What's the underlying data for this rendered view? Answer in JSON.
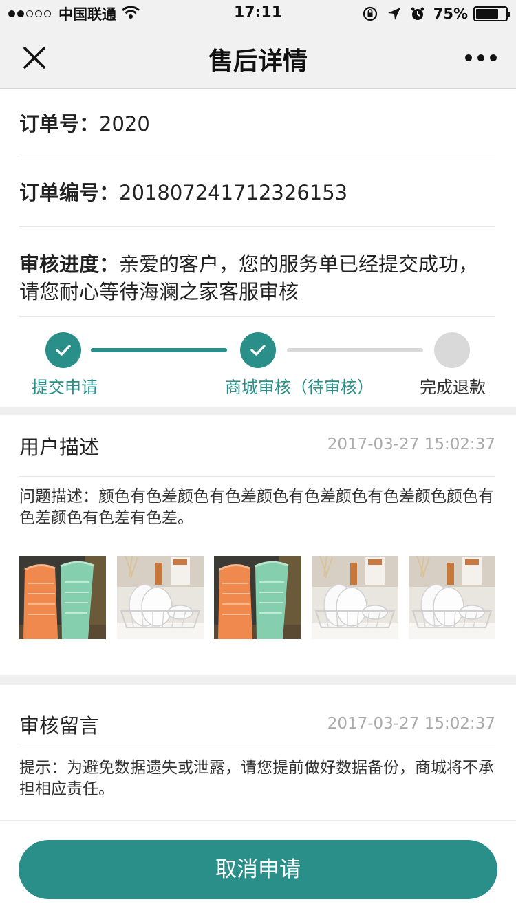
{
  "status_bar": {
    "carrier": "中国联通",
    "time": "17:11",
    "battery_percent": "75%",
    "battery_level": 0.75,
    "signal_bars_filled": 2,
    "signal_bars_total": 5,
    "icons": [
      "wifi-icon",
      "orientation-lock-icon",
      "location-arrow-icon",
      "alarm-icon",
      "battery-icon"
    ]
  },
  "nav": {
    "title": "售后详情",
    "close_icon": "close-icon",
    "more_icon": "more-dots-icon"
  },
  "order": {
    "order_label": "订单号：",
    "order_value": "2020",
    "number_label": "订单编号：",
    "number_value": "20180724171232615​3",
    "progress_label": "审核进度：",
    "progress_text": "亲爱的客户，您的服务单已经提交成功，请您耐心等待海澜之家客服审核"
  },
  "steps": [
    {
      "label": "提交申请",
      "state": "done"
    },
    {
      "label": "商城审核（待审核）",
      "state": "done"
    },
    {
      "label": "完成退款",
      "state": "pending"
    }
  ],
  "user_description": {
    "title": "用户描述",
    "time": "2017-03-27   15:02:37",
    "text": "问题描述：颜色有色差颜色有色差颜色有色差颜色有色差颜色颜色有色差颜色有色差有色差。",
    "images": [
      "towel-rolls-photo",
      "dish-rack-photo",
      "towel-rolls-photo",
      "dish-rack-photo",
      "dish-rack-photo"
    ]
  },
  "review_message": {
    "title": "审核留言",
    "time": "2017-03-27   15:02:37",
    "text": "提示：为避免数据遗失或泄露，请您提前做好数据备份，商城将不承担相应责任。"
  },
  "actions": {
    "cancel_label": "取消申请"
  },
  "colors": {
    "accent": "#2a8f89",
    "pending": "#d9d9d9",
    "muted_text": "#aaaaaa"
  }
}
